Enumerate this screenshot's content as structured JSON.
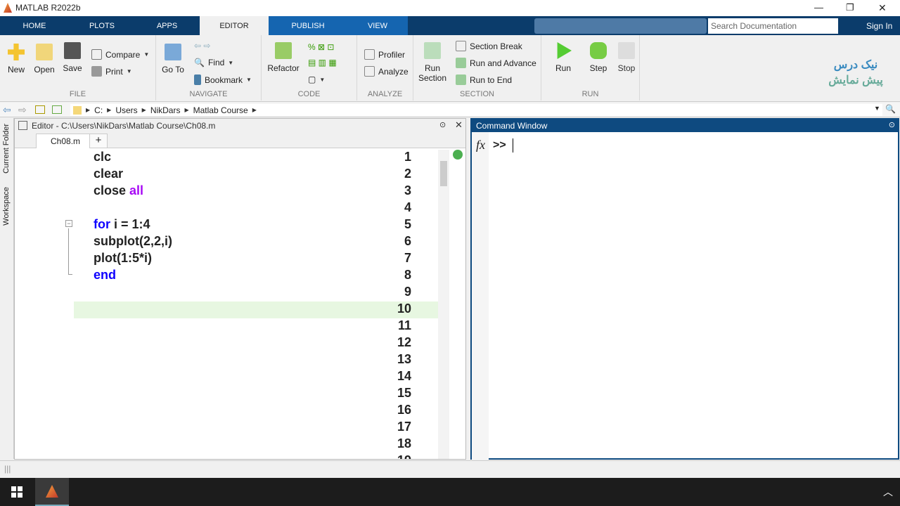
{
  "window": {
    "title": "MATLAB R2022b",
    "min": "—",
    "max": "❐",
    "close": "✕"
  },
  "tabs": [
    {
      "label": "HOME"
    },
    {
      "label": "PLOTS"
    },
    {
      "label": "APPS"
    },
    {
      "label": "EDITOR",
      "active": true
    },
    {
      "label": "PUBLISH"
    },
    {
      "label": "VIEW"
    }
  ],
  "search": {
    "placeholder": "Search Documentation"
  },
  "signin": "Sign In",
  "watermark": {
    "line1": "نیک درس",
    "line2": "پیش نمایش"
  },
  "ribbon": {
    "file": {
      "label": "FILE",
      "new": "New",
      "open": "Open",
      "save": "Save",
      "compare": "Compare",
      "print": "Print"
    },
    "navigate": {
      "label": "NAVIGATE",
      "goto": "Go To",
      "find": "Find",
      "bookmark": "Bookmark"
    },
    "code": {
      "label": "CODE",
      "refactor": "Refactor"
    },
    "analyze": {
      "label": "ANALYZE",
      "profiler": "Profiler",
      "analyze": "Analyze"
    },
    "section": {
      "label": "SECTION",
      "run_section": "Run Section",
      "section_break": "Section Break",
      "run_advance": "Run and Advance",
      "run_end": "Run to End"
    },
    "run": {
      "label": "RUN",
      "run": "Run",
      "step": "Step",
      "stop": "Stop"
    }
  },
  "path": [
    "C:",
    "Users",
    "NikDars",
    "Matlab Course"
  ],
  "side_tabs": [
    "Current Folder",
    "Workspace"
  ],
  "editor": {
    "title": "Editor - C:\\Users\\NikDars\\Matlab Course\\Ch08.m",
    "tab": "Ch08.m",
    "add_tab": "+",
    "lines": [
      [
        {
          "t": "clc"
        }
      ],
      [
        {
          "t": "clear"
        }
      ],
      [
        {
          "t": "close "
        },
        {
          "t": "all",
          "c": "str"
        }
      ],
      [],
      [
        {
          "t": "for",
          "c": "kw"
        },
        {
          "t": " i = 1:4"
        }
      ],
      [
        {
          "t": "subplot(2,2,i)"
        }
      ],
      [
        {
          "t": "plot(1:5*i)"
        }
      ],
      [
        {
          "t": "end",
          "c": "kw"
        }
      ],
      [],
      [],
      [],
      [],
      [],
      [],
      [],
      [],
      [],
      [],
      []
    ],
    "current_line": 10
  },
  "command_window": {
    "title": "Command Window",
    "fx": "fx",
    "prompt": ">>"
  },
  "colors": {
    "tabbar": "#0b3c6b",
    "panel_header": "#0e4a80",
    "keyword": "#0e00ff",
    "string": "#a709f5",
    "current_line": "#e7f7e1"
  }
}
